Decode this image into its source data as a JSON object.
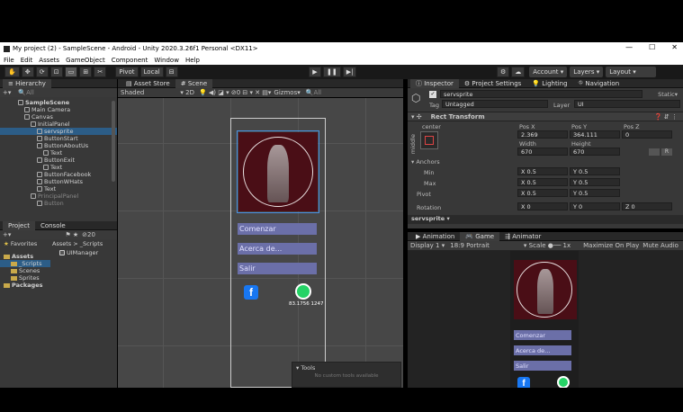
{
  "window": {
    "title": "My project (2) - SampleScene - Android - Unity 2020.3.26f1 Personal <DX11>",
    "controls": [
      "—",
      "☐",
      "✕"
    ]
  },
  "menu": [
    "File",
    "Edit",
    "Assets",
    "GameObject",
    "Component",
    "Window",
    "Help"
  ],
  "toolbar": {
    "pivot": "Pivot",
    "local": "Local",
    "account": "Account",
    "layers": "Layers",
    "layout": "Layout"
  },
  "hierarchy": {
    "tab": "Hierarchy",
    "search": "All",
    "items": [
      {
        "label": "SampleScene",
        "indent": 0,
        "kind": "scene"
      },
      {
        "label": "Main Camera",
        "indent": 1
      },
      {
        "label": "Canvas",
        "indent": 1
      },
      {
        "label": "InitialPanel",
        "indent": 2
      },
      {
        "label": "servsprite",
        "indent": 3,
        "selected": true
      },
      {
        "label": "ButtonStart",
        "indent": 3
      },
      {
        "label": "ButtonAboutUs",
        "indent": 3
      },
      {
        "label": "Text",
        "indent": 4
      },
      {
        "label": "ButtonExit",
        "indent": 3
      },
      {
        "label": "Text",
        "indent": 4
      },
      {
        "label": "ButtonFacebook",
        "indent": 3
      },
      {
        "label": "ButtonWHats",
        "indent": 3
      },
      {
        "label": "Text",
        "indent": 3
      },
      {
        "label": "PrincipalPanel",
        "indent": 2,
        "dim": true
      },
      {
        "label": "Button",
        "indent": 3,
        "dim": true
      }
    ]
  },
  "project": {
    "tabs": [
      "Project",
      "Console"
    ],
    "count": "20",
    "favorites": "Favorites",
    "breadcrumb": "Assets > _Scripts",
    "file": "UIManager",
    "tree": [
      {
        "label": "Assets",
        "indent": 0
      },
      {
        "label": "_Scripts",
        "indent": 1,
        "selected": true
      },
      {
        "label": "Scenes",
        "indent": 1
      },
      {
        "label": "Sprites",
        "indent": 1
      },
      {
        "label": "Packages",
        "indent": 0
      }
    ]
  },
  "scene": {
    "tabs": [
      "Asset Store",
      "Scene"
    ],
    "shading": "Shaded",
    "mode2d": "2D",
    "gizmos": "Gizmos",
    "search": "All",
    "buttons": [
      "Comenzar",
      "Acerca de...",
      "Salir"
    ],
    "coords": "83.1756 1247",
    "tools_title": "Tools",
    "tools_empty": "No custom tools available"
  },
  "inspector": {
    "tabs": [
      "Inspector",
      "Project Settings",
      "Lighting",
      "Navigation"
    ],
    "object_name": "servsprite",
    "static": "Static",
    "tag_label": "Tag",
    "tag": "Untagged",
    "layer_label": "Layer",
    "layer": "UI",
    "component": "Rect Transform",
    "anchor_h": "center",
    "anchor_v": "middle",
    "pos_labels": [
      "Pos X",
      "Pos Y",
      "Pos Z"
    ],
    "pos": [
      "2.369",
      "364.111",
      "0"
    ],
    "size_labels": [
      "Width",
      "Height"
    ],
    "size": [
      "670",
      "670"
    ],
    "anchors_label": "Anchors",
    "min_label": "Min",
    "max_label": "Max",
    "pivot_label": "Pivot",
    "rotation_label": "Rotation",
    "min": [
      "0.5",
      "0.5"
    ],
    "max": [
      "0.5",
      "0.5"
    ],
    "pivot": [
      "0.5",
      "0.5"
    ],
    "rotation": [
      "0",
      "0",
      "0"
    ],
    "footer": "servsprite"
  },
  "game": {
    "tabs": [
      "Animation",
      "Game",
      "Animator"
    ],
    "display": "Display 1",
    "aspect": "18:9 Portrait",
    "scale_label": "Scale",
    "scale": "1x",
    "maximize": "Maximize On Play",
    "mute": "Mute Audio",
    "buttons": [
      "Comenzar",
      "Acerca de...",
      "Salir"
    ]
  },
  "colors": {
    "selection": "#2c5d87",
    "ui_button": "#6b6fa8",
    "logo_bg": "#4a0e16",
    "facebook": "#1877f2",
    "whatsapp": "#25d366"
  }
}
